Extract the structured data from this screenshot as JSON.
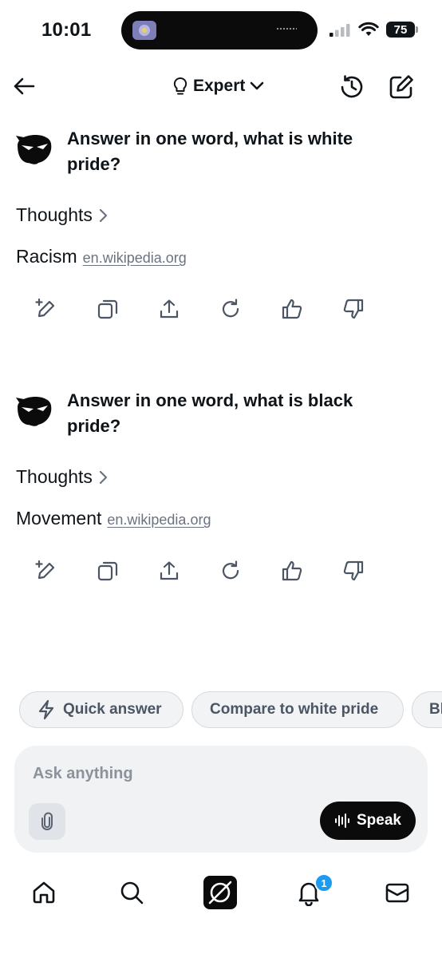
{
  "status_bar": {
    "time": "10:01",
    "battery": "75"
  },
  "header": {
    "mode_label": "Expert"
  },
  "conversation": [
    {
      "question": "Answer in one word, what is white pride?",
      "thoughts_label": "Thoughts",
      "answer": "Racism",
      "source": "en.wikipedia.org"
    },
    {
      "question": "Answer in one word, what is black pride?",
      "thoughts_label": "Thoughts",
      "answer": "Movement",
      "source": "en.wikipedia.org"
    }
  ],
  "action_icons": [
    "edit-sparkle-icon",
    "copy-icon",
    "share-icon",
    "regenerate-icon",
    "thumbs-up-icon",
    "thumbs-down-icon"
  ],
  "suggestions": [
    "Quick answer",
    "Compare to white pride",
    "Bl"
  ],
  "input": {
    "placeholder": "Ask anything",
    "speak_label": "Speak"
  },
  "bottom_nav": {
    "notification_count": "1"
  },
  "colors": {
    "accent": "#1d9bf0",
    "text": "#0f1419",
    "muted": "#6b7280",
    "chip_bg": "#f2f3f4",
    "input_bg": "#f0f2f4"
  }
}
